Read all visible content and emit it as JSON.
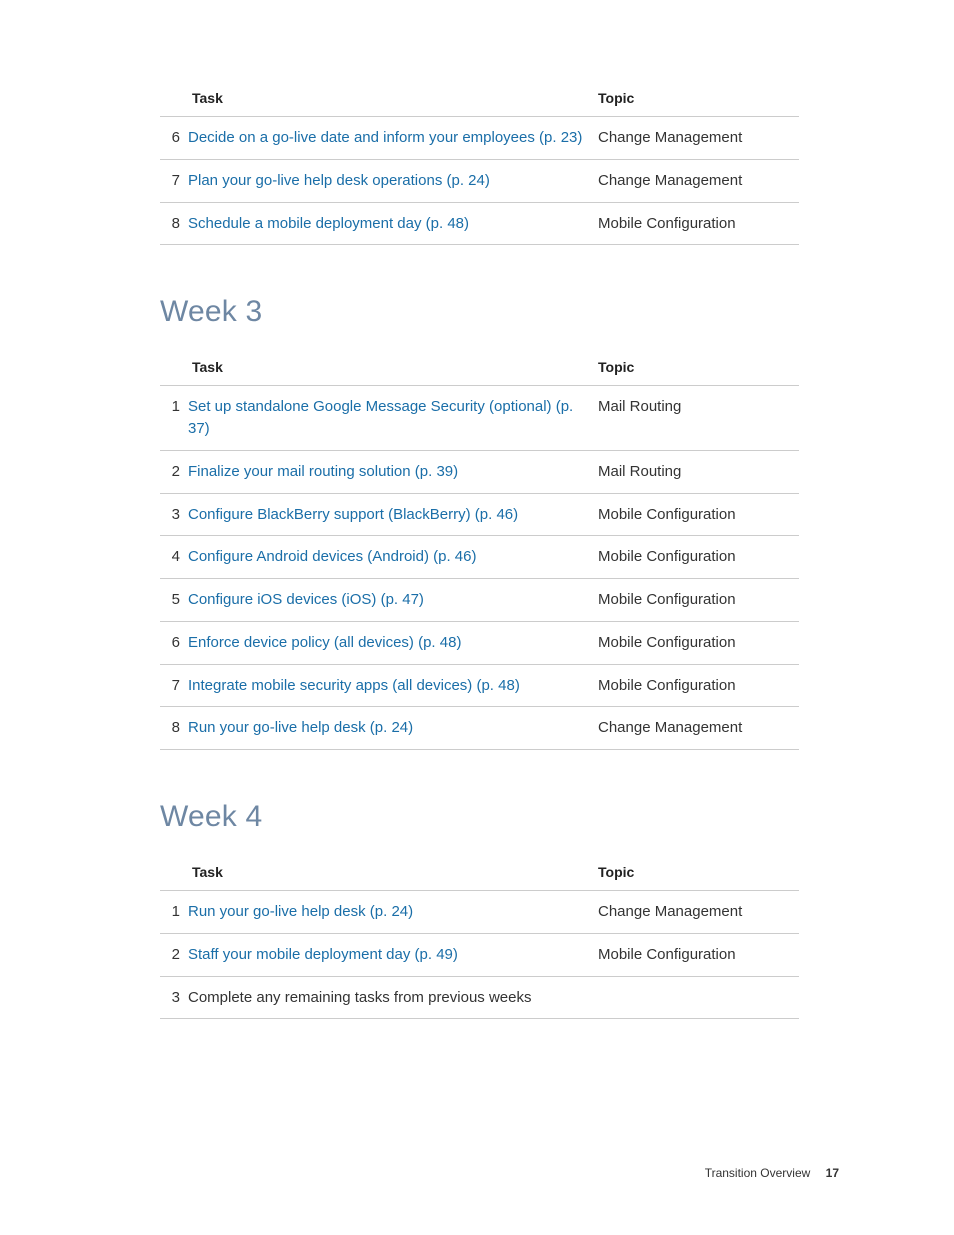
{
  "columns": {
    "task": "Task",
    "topic": "Topic"
  },
  "topBlock": {
    "rows": [
      {
        "num": "6",
        "task": "Decide on a go-live date and inform your employees (p. 23)",
        "link": true,
        "topic": "Change Management"
      },
      {
        "num": "7",
        "task": "Plan your go-live help desk operations (p. 24)",
        "link": true,
        "topic": "Change Management"
      },
      {
        "num": "8",
        "task": "Schedule a mobile deployment day (p. 48)",
        "link": true,
        "topic": "Mobile Configuration"
      }
    ]
  },
  "week3": {
    "heading": "Week 3",
    "rows": [
      {
        "num": "1",
        "task": "Set up standalone Google Message Security (optional) (p. 37)",
        "link": true,
        "topic": "Mail Routing"
      },
      {
        "num": "2",
        "task": "Finalize your mail routing solution (p. 39)",
        "link": true,
        "topic": "Mail Routing"
      },
      {
        "num": "3",
        "task": "Configure BlackBerry support (BlackBerry) (p. 46)",
        "link": true,
        "topic": "Mobile Configuration"
      },
      {
        "num": "4",
        "task": "Configure Android devices (Android) (p. 46)",
        "link": true,
        "topic": "Mobile Configuration"
      },
      {
        "num": "5",
        "task": "Configure iOS devices (iOS) (p. 47)",
        "link": true,
        "topic": "Mobile Configuration"
      },
      {
        "num": "6",
        "task": "Enforce device policy (all devices) (p. 48)",
        "link": true,
        "topic": "Mobile Configuration"
      },
      {
        "num": "7",
        "task": "Integrate mobile security apps (all devices) (p. 48)",
        "link": true,
        "topic": "Mobile Configuration"
      },
      {
        "num": "8",
        "task": "Run your go-live help desk (p. 24)",
        "link": true,
        "topic": "Change Management"
      }
    ]
  },
  "week4": {
    "heading": "Week 4",
    "rows": [
      {
        "num": "1",
        "task": "Run your go-live help desk (p. 24)",
        "link": true,
        "topic": "Change Management"
      },
      {
        "num": "2",
        "task": "Staff your mobile deployment day (p. 49)",
        "link": true,
        "topic": "Mobile Configuration"
      },
      {
        "num": "3",
        "task": "Complete any remaining tasks from previous weeks",
        "link": false,
        "topic": ""
      }
    ]
  },
  "footer": {
    "section": "Transition Overview",
    "page": "17"
  }
}
